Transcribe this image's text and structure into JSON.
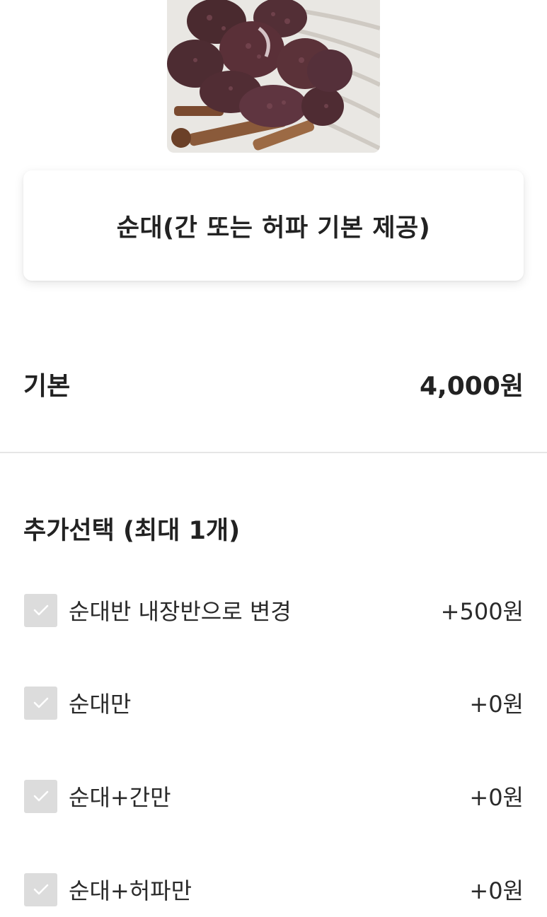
{
  "product": {
    "name": "순대(간 또는 허파 기본 제공)"
  },
  "base": {
    "label": "기본",
    "price": "4,000원"
  },
  "options_group": {
    "title": "추가선택 (최대 1개)",
    "items": [
      {
        "label": "순대반 내장반으로 변경",
        "price": "+500원",
        "checked": false
      },
      {
        "label": "순대만",
        "price": "+0원",
        "checked": false
      },
      {
        "label": "순대+간만",
        "price": "+0원",
        "checked": false
      },
      {
        "label": "순대+허파만",
        "price": "+0원",
        "checked": false
      }
    ]
  },
  "colors": {
    "checkbox_bg": "#dcdcdc",
    "checkmark": "#ffffff",
    "divider": "#e6e6e6",
    "text": "#222222"
  }
}
